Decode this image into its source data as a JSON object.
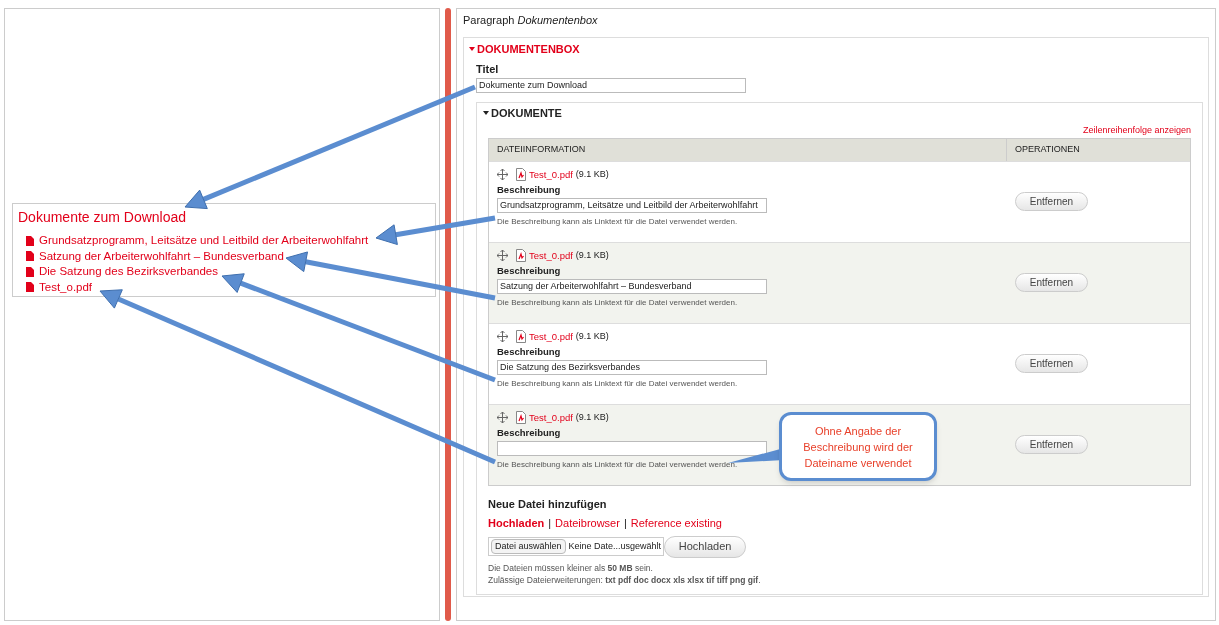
{
  "preview": {
    "title": "Dokumente zum Download",
    "links": [
      {
        "label": "Grundsatzprogramm, Leitsätze und Leitbild der Arbeiterwohlfahrt"
      },
      {
        "label": "Satzung der Arbeiterwohlfahrt – Bundesverband"
      },
      {
        "label": "Die Satzung des Bezirksverbandes"
      },
      {
        "label": "Test_o.pdf"
      }
    ]
  },
  "paragraph": {
    "label": "Paragraph",
    "type": "Dokumentenbox"
  },
  "fieldset": {
    "legend": "DOKUMENTENBOX",
    "expanded": true,
    "title_label": "Titel",
    "title_value": "Dokumente zum Download"
  },
  "documents": {
    "legend": "DOKUMENTE",
    "expanded": true,
    "row_order_link": "Zeilenreihenfolge anzeigen",
    "columns": [
      "DATEIINFORMATION",
      "OPERATIONEN"
    ],
    "rows": [
      {
        "file": "Test_0.pdf",
        "size": "(9.1 KB)",
        "label": "Beschreibung",
        "value": "Grundsatzprogramm, Leitsätze und Leitbild der Arbeiterwohlfahrt",
        "help": "Die Beschreibung kann als Linktext für die Datei verwendet werden.",
        "button": "Entfernen"
      },
      {
        "file": "Test_0.pdf",
        "size": "(9.1 KB)",
        "label": "Beschreibung",
        "value": "Satzung der Arbeiterwohlfahrt – Bundesverband",
        "help": "Die Beschreibung kann als Linktext für die Datei verwendet werden.",
        "button": "Entfernen"
      },
      {
        "file": "Test_0.pdf",
        "size": "(9.1 KB)",
        "label": "Beschreibung",
        "value": "Die Satzung des Bezirksverbandes",
        "help": "Die Beschreibung kann als Linktext für die Datei verwendet werden.",
        "button": "Entfernen"
      },
      {
        "file": "Test_0.pdf",
        "size": "(9.1 KB)",
        "label": "Beschreibung",
        "help": "Die Beschreibung kann als Linktext für die Datei verwendet werden.",
        "button": "Entfernen"
      }
    ]
  },
  "upload": {
    "heading": "Neue Datei hinzufügen",
    "sources": [
      {
        "label": "Hochladen",
        "selected": true
      },
      {
        "label": "Dateibrowser",
        "selected": false
      },
      {
        "label": "Reference existing",
        "selected": false
      }
    ],
    "separator": "|",
    "choose_button": "Datei auswählen",
    "no_file": "Keine Date...usgewählt",
    "upload_button": "Hochladen",
    "help": [
      "Die Dateien müssen kleiner als **50 MB** sein.",
      "Zulässige Dateierweiterungen: **txt pdf doc docx xls xlsx tif tiff png gif**."
    ]
  },
  "callout": {
    "text": "Ohne Angabe der Beschreibung wird der Dateiname verwendet"
  }
}
